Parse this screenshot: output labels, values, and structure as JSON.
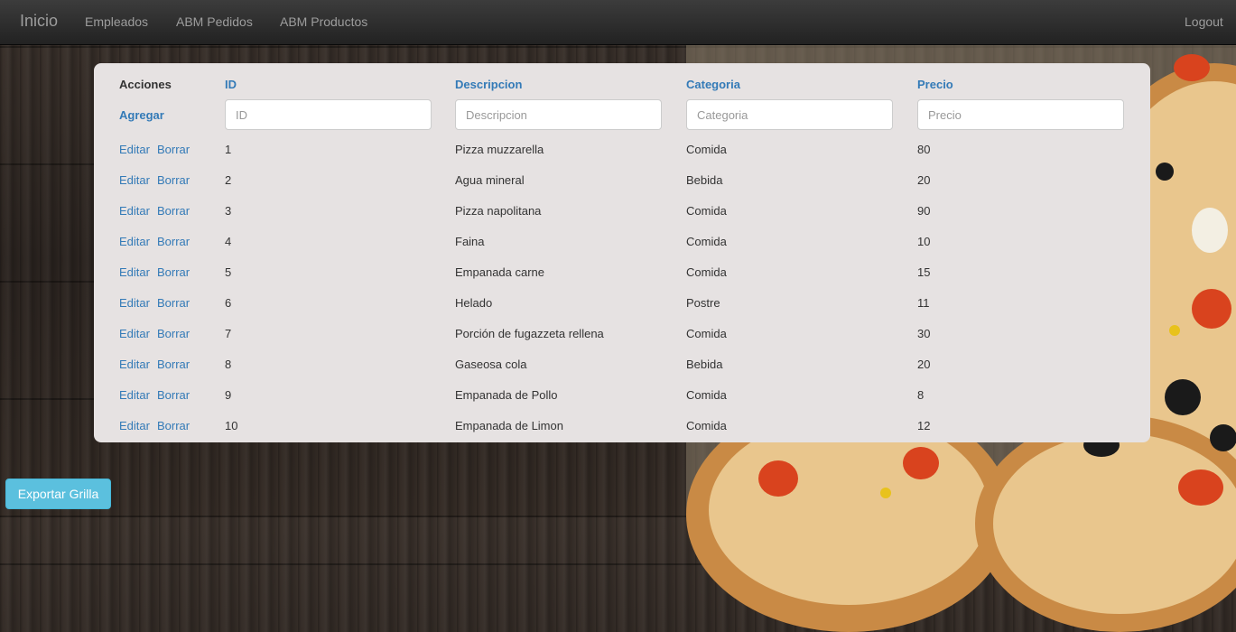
{
  "nav": {
    "brand": "Inicio",
    "links": [
      "Empleados",
      "ABM Pedidos",
      "ABM Productos"
    ],
    "logout": "Logout"
  },
  "table": {
    "headers": {
      "acciones": "Acciones",
      "id": "ID",
      "descripcion": "Descripcion",
      "categoria": "Categoria",
      "precio": "Precio"
    },
    "add_link": "Agregar",
    "filters": {
      "id_placeholder": "ID",
      "descripcion_placeholder": "Descripcion",
      "categoria_placeholder": "Categoria",
      "precio_placeholder": "Precio"
    },
    "edit_label": "Editar",
    "delete_label": "Borrar",
    "rows": [
      {
        "id": "1",
        "descripcion": "Pizza muzzarella",
        "categoria": "Comida",
        "precio": "80"
      },
      {
        "id": "2",
        "descripcion": "Agua mineral",
        "categoria": "Bebida",
        "precio": "20"
      },
      {
        "id": "3",
        "descripcion": "Pizza napolitana",
        "categoria": "Comida",
        "precio": "90"
      },
      {
        "id": "4",
        "descripcion": "Faina",
        "categoria": "Comida",
        "precio": "10"
      },
      {
        "id": "5",
        "descripcion": "Empanada carne",
        "categoria": "Comida",
        "precio": "15"
      },
      {
        "id": "6",
        "descripcion": "Helado",
        "categoria": "Postre",
        "precio": "11"
      },
      {
        "id": "7",
        "descripcion": "Porción de fugazzeta rellena",
        "categoria": "Comida",
        "precio": "30"
      },
      {
        "id": "8",
        "descripcion": "Gaseosa cola",
        "categoria": "Bebida",
        "precio": "20"
      },
      {
        "id": "9",
        "descripcion": "Empanada de Pollo",
        "categoria": "Comida",
        "precio": "8"
      },
      {
        "id": "10",
        "descripcion": "Empanada de Limon",
        "categoria": "Comida",
        "precio": "12"
      }
    ]
  },
  "export_button": "Exportar Grilla",
  "colors": {
    "link": "#337ab7",
    "panel": "#e6e2e2",
    "navbar": "#222222",
    "export_button": "#5bc0de"
  }
}
